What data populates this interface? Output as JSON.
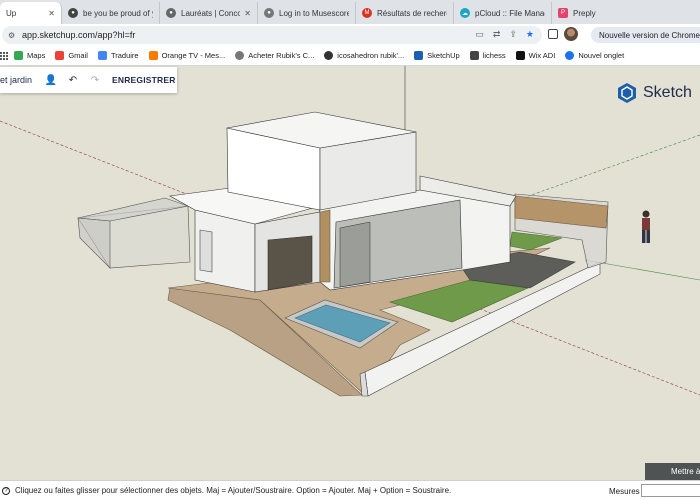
{
  "tabs": [
    {
      "label": "Up",
      "color": "#2a6fdb"
    },
    {
      "label": "be you be proud of y",
      "color": "#555555"
    },
    {
      "label": "Lauréats | Concours",
      "color": "#666666"
    },
    {
      "label": "Log in to Musescore",
      "color": "#777777"
    },
    {
      "label": "Résultats de recherc",
      "color": "#d93025"
    },
    {
      "label": "pCloud :: File Manag",
      "color": "#1aa6c5"
    },
    {
      "label": "Preply",
      "color": "#e4436e"
    }
  ],
  "address": {
    "url": "app.sketchup.com/app?hl=fr",
    "update_notice": "Nouvelle version de Chrome dis"
  },
  "bookmarks": [
    {
      "label": "Maps",
      "color": "#34a853"
    },
    {
      "label": "Gmail",
      "color": "#ea4335"
    },
    {
      "label": "Traduire",
      "color": "#4285f4"
    },
    {
      "label": "Orange TV - Mes...",
      "color": "#ff7900"
    },
    {
      "label": "Acheter Rubik's C...",
      "color": "#777777"
    },
    {
      "label": "icosahedron rubik'...",
      "color": "#333333"
    },
    {
      "label": "SketchUp",
      "color": "#1a5fb4"
    },
    {
      "label": "lichess",
      "color": "#444444"
    },
    {
      "label": "Wix ADI",
      "color": "#111111"
    },
    {
      "label": "Nouvel onglet",
      "color": "#1a73e8"
    }
  ],
  "sketchup": {
    "title": "et jardin",
    "save_label": "ENREGISTRER",
    "logo_text": "Sketch",
    "mettre_label": "Mettre à"
  },
  "status": {
    "hint": "Cliquez ou faites glisser pour sélectionner des objets. Maj = Ajouter/Soustraire. Option = Ajouter. Maj + Option = Soustraire.",
    "measures_label": "Mesures"
  }
}
